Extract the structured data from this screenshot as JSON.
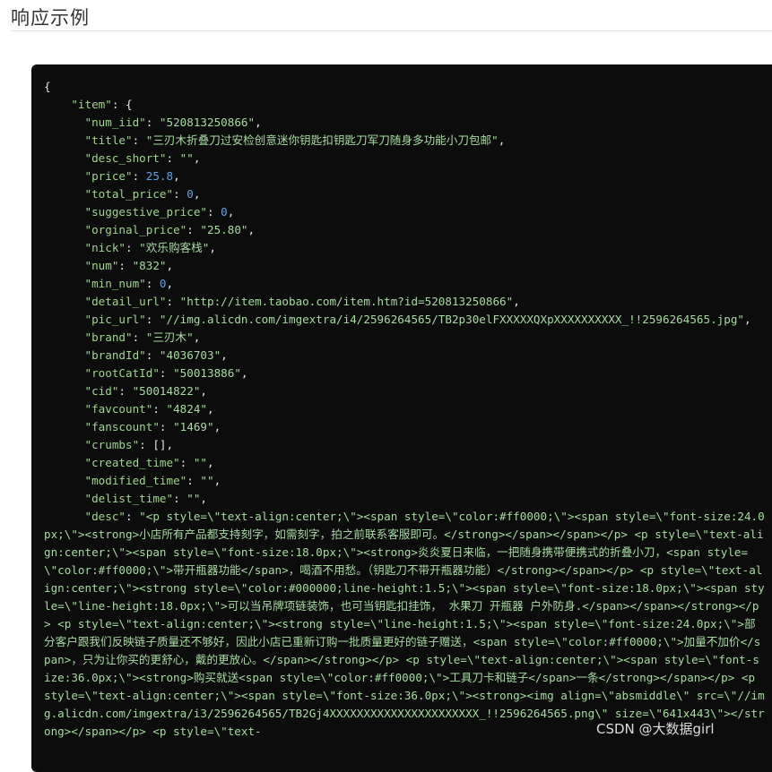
{
  "section": {
    "title": "响应示例"
  },
  "code": {
    "lines": [
      {
        "indent": "",
        "key": "",
        "sep": "",
        "value": "{",
        "vtype": "p",
        "tail": ""
      },
      {
        "indent": "    ",
        "key": "\"item\"",
        "sep": ": ",
        "value": "{",
        "vtype": "p",
        "tail": ""
      },
      {
        "indent": "      ",
        "key": "\"num_iid\"",
        "sep": ": ",
        "value": "\"520813250866\"",
        "vtype": "s",
        "tail": ","
      },
      {
        "indent": "      ",
        "key": "\"title\"",
        "sep": ": ",
        "value": "\"三刃木折叠刀过安检创意迷你钥匙扣钥匙刀军刀随身多功能小刀包邮\"",
        "vtype": "s",
        "tail": ","
      },
      {
        "indent": "      ",
        "key": "\"desc_short\"",
        "sep": ": ",
        "value": "\"\"",
        "vtype": "s",
        "tail": ","
      },
      {
        "indent": "      ",
        "key": "\"price\"",
        "sep": ": ",
        "value": "25.8",
        "vtype": "n",
        "tail": ","
      },
      {
        "indent": "      ",
        "key": "\"total_price\"",
        "sep": ": ",
        "value": "0",
        "vtype": "n",
        "tail": ","
      },
      {
        "indent": "      ",
        "key": "\"suggestive_price\"",
        "sep": ": ",
        "value": "0",
        "vtype": "n",
        "tail": ","
      },
      {
        "indent": "      ",
        "key": "\"orginal_price\"",
        "sep": ": ",
        "value": "\"25.80\"",
        "vtype": "s",
        "tail": ","
      },
      {
        "indent": "      ",
        "key": "\"nick\"",
        "sep": ": ",
        "value": "\"欢乐购客栈\"",
        "vtype": "s",
        "tail": ","
      },
      {
        "indent": "      ",
        "key": "\"num\"",
        "sep": ": ",
        "value": "\"832\"",
        "vtype": "s",
        "tail": ","
      },
      {
        "indent": "      ",
        "key": "\"min_num\"",
        "sep": ": ",
        "value": "0",
        "vtype": "n",
        "tail": ","
      },
      {
        "indent": "      ",
        "key": "\"detail_url\"",
        "sep": ": ",
        "value": "\"http://item.taobao.com/item.htm?id=520813250866\"",
        "vtype": "s",
        "tail": ","
      },
      {
        "indent": "      ",
        "key": "\"pic_url\"",
        "sep": ": ",
        "value": "\"//img.alicdn.com/imgextra/i4/2596264565/TB2p30elFXXXXXQXpXXXXXXXXXX_!!2596264565.jpg\"",
        "vtype": "s",
        "tail": ","
      },
      {
        "indent": "      ",
        "key": "\"brand\"",
        "sep": ": ",
        "value": "\"三刃木\"",
        "vtype": "s",
        "tail": ","
      },
      {
        "indent": "      ",
        "key": "\"brandId\"",
        "sep": ": ",
        "value": "\"4036703\"",
        "vtype": "s",
        "tail": ","
      },
      {
        "indent": "      ",
        "key": "\"rootCatId\"",
        "sep": ": ",
        "value": "\"50013886\"",
        "vtype": "s",
        "tail": ","
      },
      {
        "indent": "      ",
        "key": "\"cid\"",
        "sep": ": ",
        "value": "\"50014822\"",
        "vtype": "s",
        "tail": ","
      },
      {
        "indent": "      ",
        "key": "\"favcount\"",
        "sep": ": ",
        "value": "\"4824\"",
        "vtype": "s",
        "tail": ","
      },
      {
        "indent": "      ",
        "key": "\"fanscount\"",
        "sep": ": ",
        "value": "\"1469\"",
        "vtype": "s",
        "tail": ","
      },
      {
        "indent": "      ",
        "key": "\"crumbs\"",
        "sep": ": ",
        "value": "[]",
        "vtype": "p",
        "tail": ","
      },
      {
        "indent": "      ",
        "key": "\"created_time\"",
        "sep": ": ",
        "value": "\"\"",
        "vtype": "s",
        "tail": ","
      },
      {
        "indent": "      ",
        "key": "\"modified_time\"",
        "sep": ": ",
        "value": "\"\"",
        "vtype": "s",
        "tail": ","
      },
      {
        "indent": "      ",
        "key": "\"delist_time\"",
        "sep": ": ",
        "value": "\"\"",
        "vtype": "s",
        "tail": ","
      },
      {
        "indent": "      ",
        "key": "\"desc\"",
        "sep": ": ",
        "value": "\"<p style=\\\"text-align:center;\\\"><span style=\\\"color:#ff0000;\\\"><span style=\\\"font-size:24.0px;\\\"><strong>小店所有产品都支持刻字，如需刻字，拍之前联系客服即可。</strong></span></span></p> <p style=\\\"text-align:center;\\\"><span style=\\\"font-size:18.0px;\\\"><strong>炎炎夏日来临，一把随身携带便携式的折叠小刀，<span style=\\\"color:#ff0000;\\\">带开瓶器功能</span>，喝酒不用愁。（钥匙刀不带开瓶器功能）</strong></span></p> <p style=\\\"text-align:center;\\\"><strong style=\\\"color:#000000;line-height:1.5;\\\"><span style=\\\"font-size:18.0px;\\\"><span style=\\\"line-height:18.0px;\\\">可以当吊牌项链装饰，也可当钥匙扣挂饰， 水果刀 开瓶器 户外防身.</span></span></strong></p> <p style=\\\"text-align:center;\\\"><strong style=\\\"line-height:1.5;\\\"><span style=\\\"font-size:24.0px;\\\">部分客户跟我们反映链子质量还不够好，因此小店已重新订购一批质量更好的链子赠送，<span style=\\\"color:#ff0000;\\\">加量不加价</span>，只为让你买的更舒心，戴的更放心。</span></strong></p> <p style=\\\"text-align:center;\\\"><span style=\\\"font-size:36.0px;\\\"><strong>购买就送<span style=\\\"color:#ff0000;\\\">工具刀卡和链子</span>一条</strong></span></p> <p style=\\\"text-align:center;\\\"><span style=\\\"font-size:36.0px;\\\"><strong><img align=\\\"absmiddle\\\" src=\\\"//img.alicdn.com/imgextra/i3/2596264565/TB2Gj4XXXXXXXXXXXXXXXXXXXXXX_!!2596264565.png\\\" size=\\\"641x443\\\"></strong></span></p> <p style=\\\"text-",
        "vtype": "s",
        "tail": ""
      }
    ]
  },
  "watermark": {
    "text": "CSDN @大数据girl"
  }
}
